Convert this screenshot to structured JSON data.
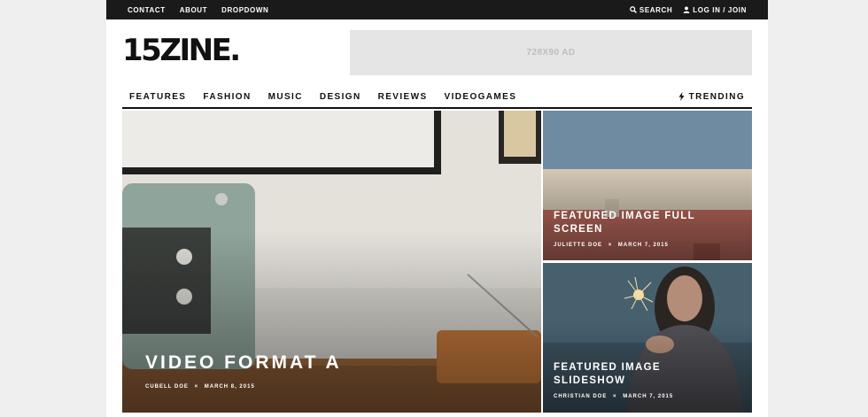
{
  "topbar": {
    "links": [
      "CONTACT",
      "ABOUT",
      "DROPDOWN"
    ],
    "search_label": "SEARCH",
    "login_label": "LOG IN / JOIN"
  },
  "header": {
    "logo": "15ZINE.",
    "ad_text": "728X90 AD"
  },
  "mainnav": {
    "items": [
      "FEATURES",
      "FASHION",
      "MUSIC",
      "DESIGN",
      "REVIEWS",
      "VIDEOGAMES"
    ],
    "trending_label": "TRENDING"
  },
  "posts": [
    {
      "title": "VIDEO FORMAT A",
      "author": "CUBELL DOE",
      "date": "MARCH 8, 2015",
      "separator": "×"
    },
    {
      "title": "FEATURED IMAGE FULL SCREEN",
      "author": "JULIETTE DOE",
      "date": "MARCH 7, 2015",
      "separator": "×"
    },
    {
      "title": "FEATURED IMAGE SLIDESHOW",
      "author": "CHRISTIAN DOE",
      "date": "MARCH 7, 2015",
      "separator": "×"
    }
  ],
  "colors": {
    "topbar_bg": "#1a1a1a",
    "page_bg": "#efefef",
    "ad_bg": "#e5e5e5"
  }
}
